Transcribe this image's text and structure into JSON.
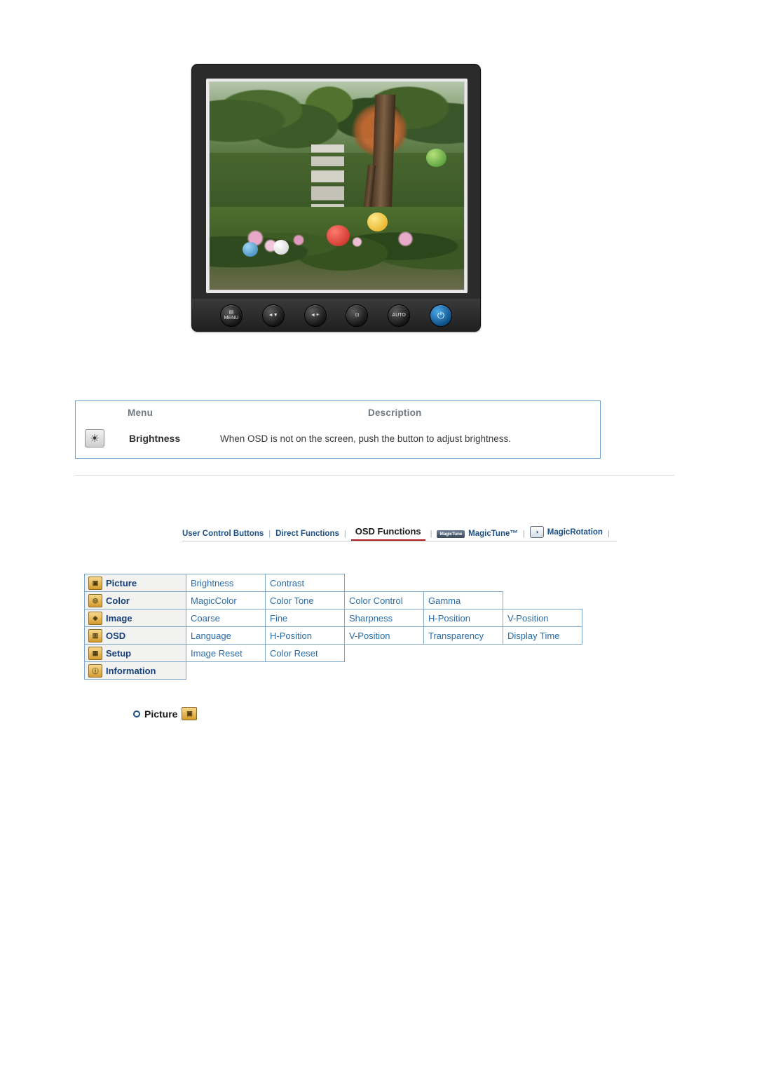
{
  "monitor": {
    "alt": "LCD monitor displaying a garden photograph with a stone pagoda",
    "buttons": [
      {
        "name": "menu-button",
        "label": "MENU",
        "icon": "menu-icon"
      },
      {
        "name": "source-button",
        "label": "",
        "icon": "source-arrow-icon"
      },
      {
        "name": "brightness-button",
        "label": "",
        "icon": "brightness-sun-icon"
      },
      {
        "name": "enter-button",
        "label": "",
        "icon": "enter-icon"
      },
      {
        "name": "auto-button",
        "label": "AUTO",
        "icon": "auto-icon"
      },
      {
        "name": "power-button",
        "label": "",
        "icon": "power-icon"
      }
    ]
  },
  "description_table": {
    "headers": {
      "menu": "Menu",
      "description": "Description"
    },
    "row": {
      "icon": "brightness-sun-icon",
      "menu": "Brightness",
      "description": "When OSD is not on the screen, push the button to adjust brightness."
    }
  },
  "tabs": {
    "separator": "|",
    "items": [
      {
        "label": "User Control Buttons",
        "active": false,
        "icon": null
      },
      {
        "label": "Direct Functions",
        "active": false,
        "icon": null
      },
      {
        "label": "OSD Functions",
        "active": true,
        "icon": null
      },
      {
        "label": "MagicTune™",
        "active": false,
        "icon": "magictune-logo-icon",
        "logo_text": "MagicTune"
      },
      {
        "label": "MagicRotation",
        "active": false,
        "icon": "magicrotation-icon"
      }
    ]
  },
  "osd_menu": {
    "rows": [
      {
        "category": "Picture",
        "icon": "picture-icon",
        "options": [
          "Brightness",
          "Contrast"
        ]
      },
      {
        "category": "Color",
        "icon": "color-icon",
        "options": [
          "MagicColor",
          "Color Tone",
          "Color Control",
          "Gamma"
        ]
      },
      {
        "category": "Image",
        "icon": "image-icon",
        "options": [
          "Coarse",
          "Fine",
          "Sharpness",
          "H-Position",
          "V-Position"
        ]
      },
      {
        "category": "OSD",
        "icon": "osd-icon",
        "options": [
          "Language",
          "H-Position",
          "V-Position",
          "Transparency",
          "Display Time"
        ]
      },
      {
        "category": "Setup",
        "icon": "setup-icon",
        "options": [
          "Image Reset",
          "Color Reset"
        ]
      },
      {
        "category": "Information",
        "icon": "information-icon",
        "options": []
      }
    ]
  },
  "section_heading": {
    "label": "Picture",
    "badge_icon": "picture-icon"
  }
}
